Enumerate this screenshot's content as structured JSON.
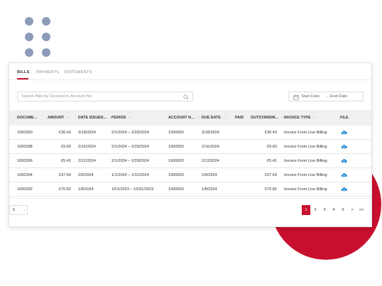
{
  "tabs": [
    {
      "label": "BILLS",
      "active": true
    },
    {
      "label": "PAYMENTS",
      "active": false
    },
    {
      "label": "STATEMENTS",
      "active": false
    }
  ],
  "search": {
    "placeholder": "Search Bills by Document, Account No",
    "icon": "search-icon"
  },
  "date_range": {
    "start_placeholder": "Start Date",
    "separator": "→",
    "end_placeholder": "End Date",
    "icon": "calendar-icon"
  },
  "table": {
    "sort_glyph": "---",
    "columns": [
      {
        "label": "DOCUME...",
        "sortable": true
      },
      {
        "label": "AMOUNT",
        "sortable": true
      },
      {
        "label": "DATE ISSUED...",
        "sortable": true
      },
      {
        "label": "PERIOD",
        "sortable": true
      },
      {
        "label": "ACCOUNT N...",
        "sortable": true
      },
      {
        "label": "DUE DATE",
        "sortable": true
      },
      {
        "label": "PAID",
        "sortable": false
      },
      {
        "label": "OUTSTANDIN...",
        "sortable": true
      },
      {
        "label": "INVOICE TYPE",
        "sortable": true
      },
      {
        "label": "FILE",
        "sortable": false
      }
    ],
    "rows": [
      {
        "document": "1000300",
        "amount": "€36.43",
        "date_issued": "3/18/2024",
        "period": "2/1/2024 – 2/29/2024",
        "account": "1000003",
        "due_date": "3/18/2024",
        "paid": "",
        "outstanding": "€36.43",
        "invoice_type": "Invoice From Live Billing",
        "file_icon": "cloud-download-icon"
      },
      {
        "document": "1000298",
        "amount": "€9.60",
        "date_issued": "2/16/2024",
        "period": "2/1/2024 – 2/29/2024",
        "account": "1000003",
        "due_date": "2/16/2024",
        "paid": "",
        "outstanding": "€9.60",
        "invoice_type": "Invoice From Live Billing",
        "file_icon": "cloud-download-icon"
      },
      {
        "document": "1000296",
        "amount": "€5.41",
        "date_issued": "2/12/2024",
        "period": "2/1/2024 – 2/29/2024",
        "account": "1000003",
        "due_date": "2/12/2024",
        "paid": "",
        "outstanding": "€5.41",
        "invoice_type": "Invoice From Live Billing",
        "file_icon": "cloud-download-icon"
      },
      {
        "document": "1000294",
        "amount": "€37.64",
        "date_issued": "2/9/2024",
        "period": "1/1/2024 – 1/31/2024",
        "account": "1000003",
        "due_date": "2/9/2024",
        "paid": "",
        "outstanding": "€37.64",
        "invoice_type": "Invoice From Live Billing",
        "file_icon": "cloud-download-icon"
      },
      {
        "document": "1000292",
        "amount": "€70.82",
        "date_issued": "1/8/2024",
        "period": "10/1/2023 – 10/31/2023",
        "account": "1000003",
        "due_date": "1/8/2024",
        "paid": "",
        "outstanding": "€70.82",
        "invoice_type": "Invoice From Live Billing",
        "file_icon": "cloud-download-icon"
      }
    ]
  },
  "footer": {
    "page_size": "5",
    "page_size_chevron": "⌄",
    "pagination": [
      "1",
      "2",
      "3",
      "4",
      "5",
      ">",
      ">>"
    ],
    "active_page": "1"
  },
  "colors": {
    "accent": "#c8102e",
    "dots": "#8c9bb8",
    "cloud_icon": "#2a8fd6",
    "header_bg": "#eef0f2"
  }
}
